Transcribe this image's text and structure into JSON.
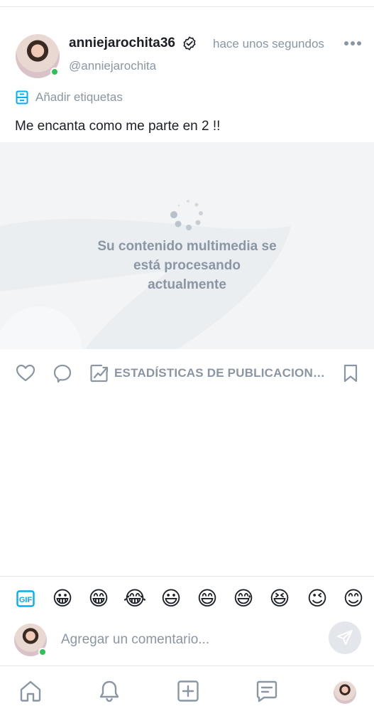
{
  "post": {
    "username": "anniejarochita36",
    "handle": "@anniejarochita",
    "timestamp": "hace unos segundos",
    "tags_label": "Añadir etiquetas",
    "text": "Me encanta como me parte en 2 !!",
    "media_status": {
      "line1": "Su contenido multimedia se",
      "line2": "está procesando",
      "line3": "actualmente"
    },
    "stats_label": "ESTADÍSTICAS DE PUBLICACION…"
  },
  "composer": {
    "placeholder": "Agregar un comentario...",
    "emojis": [
      "😀",
      "😁",
      "😂",
      "😃",
      "😄",
      "😅",
      "😆",
      "😉",
      "😊"
    ]
  },
  "icons": {
    "verified": "verified-check-icon",
    "more": "more-horizontal-icon",
    "tag": "tag-icon",
    "like": "heart-icon",
    "comment": "comment-bubble-icon",
    "stats": "chart-icon",
    "bookmark": "bookmark-icon",
    "gif": "gif-icon",
    "send": "send-icon",
    "nav": [
      "home-icon",
      "bell-icon",
      "add-square-icon",
      "messages-icon",
      "profile-avatar"
    ]
  },
  "colors": {
    "accent": "#00aff0",
    "muted": "#8a96a3",
    "online": "#2fc156",
    "media_bg": "#f2f4f6"
  }
}
